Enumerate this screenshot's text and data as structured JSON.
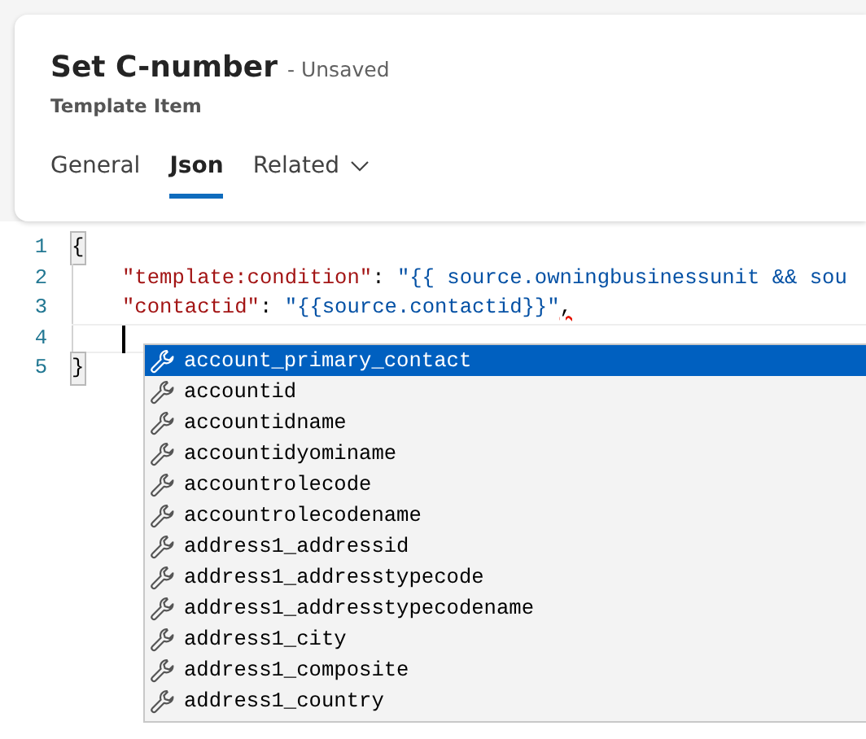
{
  "header": {
    "title": "Set C-number",
    "status": "- Unsaved",
    "subtitle": "Template Item"
  },
  "tabs": [
    {
      "label": "General",
      "selected": false,
      "kind": "plain"
    },
    {
      "label": "Json",
      "selected": true,
      "kind": "plain"
    },
    {
      "label": "Related",
      "selected": false,
      "kind": "dropdown"
    }
  ],
  "editor": {
    "lines": [
      {
        "number": "1",
        "indented": false,
        "current": false,
        "tokens": [
          {
            "kind": "matched-brace",
            "text": "{"
          }
        ]
      },
      {
        "number": "2",
        "indented": true,
        "current": false,
        "tokens": [
          {
            "kind": "key",
            "text": "\"template:condition\""
          },
          {
            "kind": "punct",
            "text": ": "
          },
          {
            "kind": "string",
            "text": "\"{{ source.owningbusinessunit && sou"
          }
        ]
      },
      {
        "number": "3",
        "indented": true,
        "current": false,
        "tokens": [
          {
            "kind": "key",
            "text": "\"contactid\""
          },
          {
            "kind": "punct",
            "text": ": "
          },
          {
            "kind": "string",
            "text": "\"{{source.contactid}}\""
          },
          {
            "kind": "error",
            "text": ","
          }
        ]
      },
      {
        "number": "4",
        "indented": true,
        "current": true
      },
      {
        "number": "5",
        "indented": false,
        "current": false,
        "tokens": [
          {
            "kind": "matched-brace",
            "text": "}"
          }
        ]
      }
    ]
  },
  "suggestions": [
    {
      "label": "account_primary_contact",
      "selected": true
    },
    {
      "label": "accountid",
      "selected": false
    },
    {
      "label": "accountidname",
      "selected": false
    },
    {
      "label": "accountidyominame",
      "selected": false
    },
    {
      "label": "accountrolecode",
      "selected": false
    },
    {
      "label": "accountrolecodename",
      "selected": false
    },
    {
      "label": "address1_addressid",
      "selected": false
    },
    {
      "label": "address1_addresstypecode",
      "selected": false
    },
    {
      "label": "address1_addresstypecodename",
      "selected": false
    },
    {
      "label": "address1_city",
      "selected": false
    },
    {
      "label": "address1_composite",
      "selected": false
    },
    {
      "label": "address1_country",
      "selected": false
    }
  ]
}
